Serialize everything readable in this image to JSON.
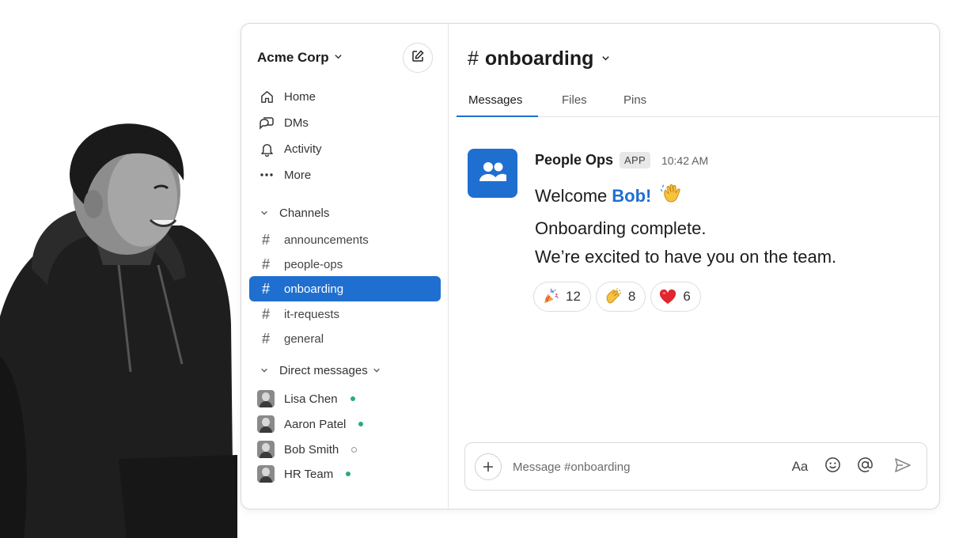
{
  "workspace": {
    "name": "Acme Corp"
  },
  "nav": [
    {
      "label": "Home",
      "icon": "home-icon"
    },
    {
      "label": "DMs",
      "icon": "chat-bubbles-icon"
    },
    {
      "label": "Activity",
      "icon": "bell-icon"
    },
    {
      "label": "More",
      "icon": "ellipsis-icon"
    }
  ],
  "channels": {
    "header": "Channels",
    "items": [
      {
        "name": "announcements",
        "active": false
      },
      {
        "name": "people-ops",
        "active": false
      },
      {
        "name": "onboarding",
        "active": true
      },
      {
        "name": "it-requests",
        "active": false
      },
      {
        "name": "general",
        "active": false
      }
    ]
  },
  "direct_messages": {
    "header": "Direct messages",
    "items": [
      {
        "name": "Lisa Chen",
        "online": true
      },
      {
        "name": "Aaron Patel",
        "online": true
      },
      {
        "name": "Bob Smith",
        "online": false
      },
      {
        "name": "HR Team",
        "online": true
      }
    ]
  },
  "channel": {
    "hash": "#",
    "title": "onboarding",
    "tabs": [
      "Messages",
      "Files",
      "Pins"
    ],
    "active_tab": "Messages"
  },
  "message": {
    "sender": "People Ops",
    "badge": "APP",
    "time": "10:42 AM",
    "welcome_prefix": "Welcome",
    "welcome_name": "Bob!",
    "welcome_emoji": "waving-hand",
    "line1": "Onboarding complete.",
    "line2": "We’re excited to have you on the team.",
    "reactions": [
      {
        "emoji": "party-popper",
        "count": "12"
      },
      {
        "emoji": "clapping-hands",
        "count": "8"
      },
      {
        "emoji": "red-heart",
        "count": "6"
      }
    ]
  },
  "composer": {
    "placeholder": "Message #onboarding",
    "format_label": "Aa"
  },
  "colors": {
    "accent": "#1f6fd0",
    "presence": "#2bac76"
  }
}
